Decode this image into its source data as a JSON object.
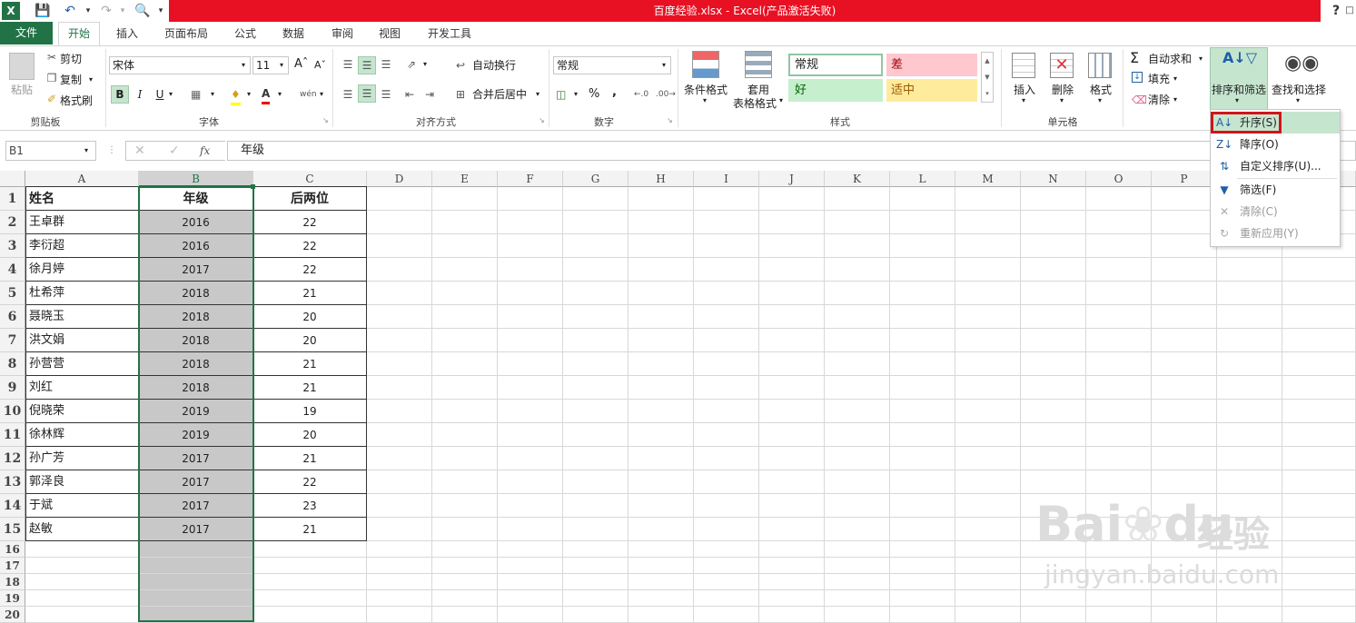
{
  "title": "百度经验.xlsx -   Excel(产品激活失败)",
  "quick_access": {
    "save": "save-icon",
    "undo": "undo-icon",
    "redo": "redo-icon",
    "preview": "print-preview-icon",
    "help": "?"
  },
  "tabs": [
    "文件",
    "开始",
    "插入",
    "页面布局",
    "公式",
    "数据",
    "审阅",
    "视图",
    "开发工具"
  ],
  "ribbon": {
    "clipboard": {
      "paste": "粘贴",
      "cut": "剪切",
      "copy": "复制",
      "format_painter": "格式刷",
      "group": "剪贴板"
    },
    "font": {
      "name": "宋体",
      "size": "11",
      "group": "字体",
      "bold": "B",
      "italic": "I",
      "underline": "U",
      "phonetic": "wén"
    },
    "alignment": {
      "wrap": "自动换行",
      "merge": "合并后居中",
      "group": "对齐方式"
    },
    "number": {
      "format": "常规",
      "group": "数字",
      "percent": "%",
      "comma": ","
    },
    "styles": {
      "cond": "条件格式",
      "table1": "套用",
      "table2": "表格格式",
      "normal": "常规",
      "bad": "差",
      "good": "好",
      "neutral": "适中",
      "group": "样式"
    },
    "cells": {
      "insert": "插入",
      "delete": "删除",
      "format": "格式",
      "group": "单元格"
    },
    "editing": {
      "autosum": "自动求和",
      "fill": "填充",
      "clear": "清除",
      "sort": "排序和筛选",
      "find": "查找和选择"
    }
  },
  "name_box": "B1",
  "formula": "年级",
  "fx": "fx",
  "columns": [
    "A",
    "B",
    "C",
    "D",
    "E",
    "F",
    "G",
    "H",
    "I",
    "J",
    "K",
    "L",
    "M",
    "N",
    "O",
    "P"
  ],
  "rows": [
    "1",
    "2",
    "3",
    "4",
    "5",
    "6",
    "7",
    "8",
    "9",
    "10",
    "11",
    "12",
    "13",
    "14",
    "15",
    "16",
    "17",
    "18",
    "19",
    "20"
  ],
  "table": {
    "headers": [
      "姓名",
      "年级",
      "后两位"
    ],
    "data": [
      [
        "王卓群",
        "2016",
        "22"
      ],
      [
        "李衍超",
        "2016",
        "22"
      ],
      [
        "徐月婷",
        "2017",
        "22"
      ],
      [
        "杜希萍",
        "2018",
        "21"
      ],
      [
        "聂晓玉",
        "2018",
        "20"
      ],
      [
        "洪文娟",
        "2018",
        "20"
      ],
      [
        "孙营营",
        "2018",
        "21"
      ],
      [
        "刘红",
        "2018",
        "21"
      ],
      [
        "倪晓荣",
        "2019",
        "19"
      ],
      [
        "徐林辉",
        "2019",
        "20"
      ],
      [
        "孙广芳",
        "2017",
        "21"
      ],
      [
        "郭泽良",
        "2017",
        "22"
      ],
      [
        "于斌",
        "2017",
        "23"
      ],
      [
        "赵敏",
        "2017",
        "21"
      ]
    ]
  },
  "sort_menu": [
    {
      "label": "升序(S)",
      "enabled": true,
      "icon": "sort-ascending-icon"
    },
    {
      "label": "降序(O)",
      "enabled": true,
      "icon": "sort-descending-icon"
    },
    {
      "label": "自定义排序(U)...",
      "enabled": true,
      "icon": "custom-sort-icon"
    },
    {
      "label": "筛选(F)",
      "enabled": true,
      "icon": "filter-icon"
    },
    {
      "label": "清除(C)",
      "enabled": false,
      "icon": "clear-filter-icon"
    },
    {
      "label": "重新应用(Y)",
      "enabled": false,
      "icon": "reapply-icon"
    }
  ],
  "watermark": {
    "brand": "Bai",
    "brand2": "du",
    "brand_cn": "经验",
    "url": "jingyan.baidu.com"
  },
  "colors": {
    "excel_green": "#217346",
    "title_red": "#e81123",
    "selection_gray": "#c8c8c8",
    "highlight": "#c6e5cf"
  }
}
